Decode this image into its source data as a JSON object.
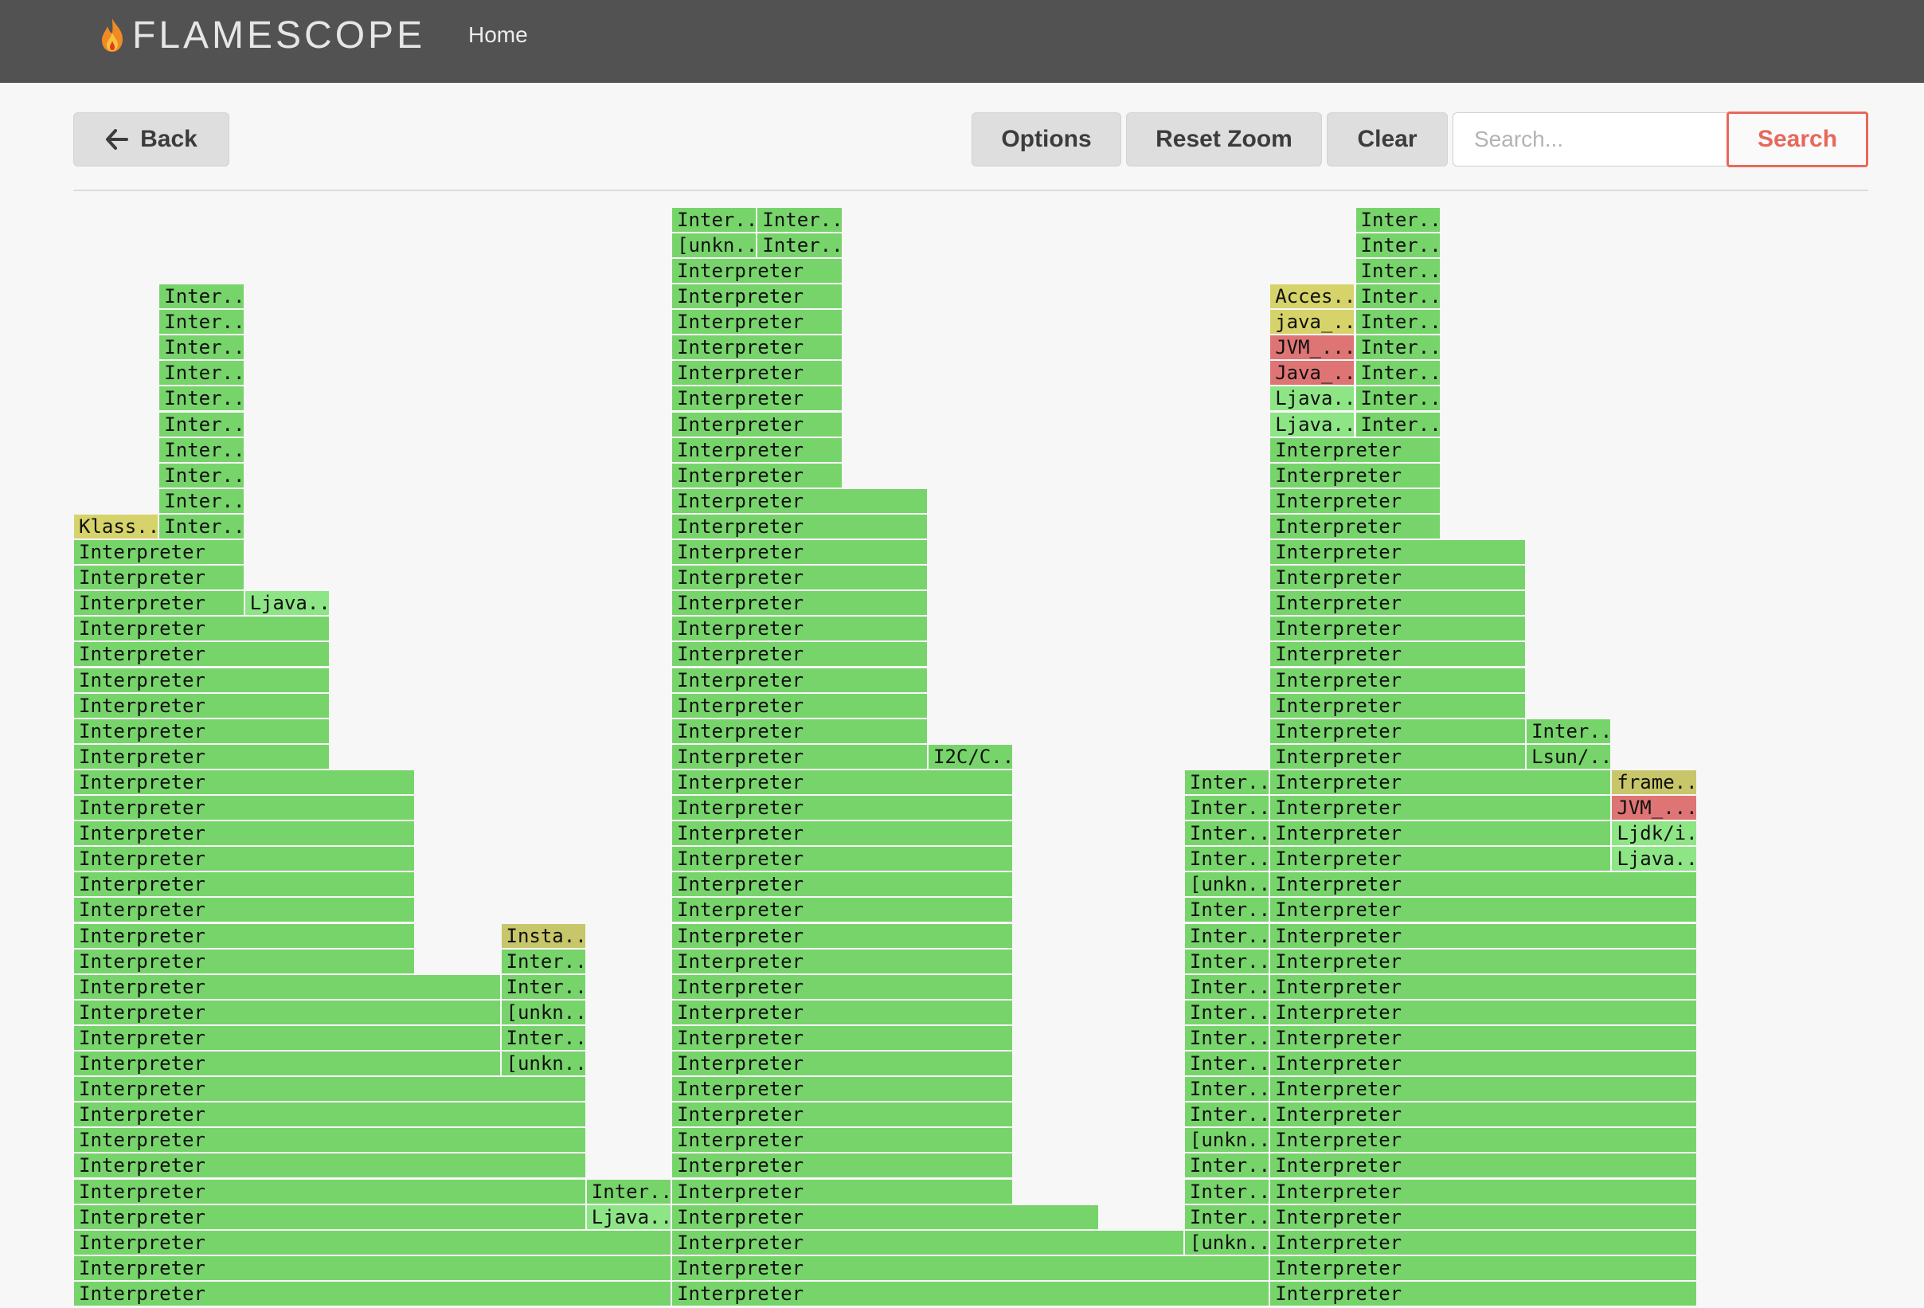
{
  "app": {
    "title": "FLAMESCOPE",
    "nav_home": "Home"
  },
  "toolbar": {
    "back_label": "Back",
    "options_label": "Options",
    "reset_zoom_label": "Reset Zoom",
    "clear_label": "Clear",
    "search_placeholder": "Search...",
    "search_label": "Search"
  },
  "colors": {
    "interpreter": "#77d46b",
    "light_green": "#8ee585",
    "yellow": "#d6d36a",
    "olive": "#c7c66a",
    "red": "#df7474",
    "accent": "#e8685a",
    "navbar": "#525252"
  },
  "flamegraph": {
    "frames": [
      {
        "c": 0,
        "r": 1,
        "w": 7,
        "t": "Interpreter",
        "k": "g"
      },
      {
        "c": 7,
        "r": 1,
        "w": 7,
        "t": "Interpreter",
        "k": "g"
      },
      {
        "c": 14,
        "r": 1,
        "w": 5,
        "t": "Interpreter",
        "k": "g"
      },
      {
        "c": 0,
        "r": 2,
        "w": 7,
        "t": "Interpreter",
        "k": "g"
      },
      {
        "c": 7,
        "r": 2,
        "w": 7,
        "t": "Interpreter",
        "k": "g"
      },
      {
        "c": 14,
        "r": 2,
        "w": 5,
        "t": "Interpreter",
        "k": "g"
      },
      {
        "c": 0,
        "r": 3,
        "w": 7,
        "t": "Interpreter",
        "k": "g"
      },
      {
        "c": 7,
        "r": 3,
        "w": 6,
        "t": "Interpreter",
        "k": "g"
      },
      {
        "c": 13,
        "r": 3,
        "w": 1,
        "t": "[unkn...",
        "k": "g"
      },
      {
        "c": 14,
        "r": 3,
        "w": 5,
        "t": "Interpreter",
        "k": "g"
      },
      {
        "c": 0,
        "r": 4,
        "w": 6,
        "t": "Interpreter",
        "k": "g"
      },
      {
        "c": 6,
        "r": 4,
        "w": 1,
        "t": "Ljava...",
        "k": "l"
      },
      {
        "c": 7,
        "r": 4,
        "w": 5,
        "t": "Interpreter",
        "k": "g"
      },
      {
        "c": 13,
        "r": 4,
        "w": 1,
        "t": "Inter...",
        "k": "g"
      },
      {
        "c": 14,
        "r": 4,
        "w": 5,
        "t": "Interpreter",
        "k": "g"
      },
      {
        "c": 0,
        "r": 5,
        "w": 6,
        "t": "Interpreter",
        "k": "g"
      },
      {
        "c": 6,
        "r": 5,
        "w": 1,
        "t": "Inter...",
        "k": "g"
      },
      {
        "c": 7,
        "r": 5,
        "w": 4,
        "t": "Interpreter",
        "k": "g"
      },
      {
        "c": 13,
        "r": 5,
        "w": 1,
        "t": "Inter...",
        "k": "g"
      },
      {
        "c": 14,
        "r": 5,
        "w": 5,
        "t": "Interpreter",
        "k": "g"
      },
      {
        "c": 0,
        "r": 6,
        "w": 6,
        "t": "Interpreter",
        "k": "g"
      },
      {
        "c": 7,
        "r": 6,
        "w": 4,
        "t": "Interpreter",
        "k": "g"
      },
      {
        "c": 13,
        "r": 6,
        "w": 1,
        "t": "Inter...",
        "k": "g"
      },
      {
        "c": 14,
        "r": 6,
        "w": 5,
        "t": "Interpreter",
        "k": "g"
      },
      {
        "c": 0,
        "r": 7,
        "w": 6,
        "t": "Interpreter",
        "k": "g"
      },
      {
        "c": 7,
        "r": 7,
        "w": 4,
        "t": "Interpreter",
        "k": "g"
      },
      {
        "c": 13,
        "r": 7,
        "w": 1,
        "t": "[unkn...",
        "k": "g"
      },
      {
        "c": 14,
        "r": 7,
        "w": 5,
        "t": "Interpreter",
        "k": "g"
      },
      {
        "c": 0,
        "r": 8,
        "w": 6,
        "t": "Interpreter",
        "k": "g"
      },
      {
        "c": 7,
        "r": 8,
        "w": 4,
        "t": "Interpreter",
        "k": "g"
      },
      {
        "c": 13,
        "r": 8,
        "w": 1,
        "t": "Inter...",
        "k": "g"
      },
      {
        "c": 14,
        "r": 8,
        "w": 5,
        "t": "Interpreter",
        "k": "g"
      },
      {
        "c": 0,
        "r": 9,
        "w": 6,
        "t": "Interpreter",
        "k": "g"
      },
      {
        "c": 7,
        "r": 9,
        "w": 4,
        "t": "Interpreter",
        "k": "g"
      },
      {
        "c": 13,
        "r": 9,
        "w": 1,
        "t": "Inter...",
        "k": "g"
      },
      {
        "c": 14,
        "r": 9,
        "w": 5,
        "t": "Interpreter",
        "k": "g"
      },
      {
        "c": 0,
        "r": 10,
        "w": 5,
        "t": "Interpreter",
        "k": "g"
      },
      {
        "c": 5,
        "r": 10,
        "w": 1,
        "t": "[unkn...",
        "k": "g"
      },
      {
        "c": 7,
        "r": 10,
        "w": 4,
        "t": "Interpreter",
        "k": "g"
      },
      {
        "c": 13,
        "r": 10,
        "w": 1,
        "t": "Inter...",
        "k": "g"
      },
      {
        "c": 14,
        "r": 10,
        "w": 5,
        "t": "Interpreter",
        "k": "g"
      },
      {
        "c": 0,
        "r": 11,
        "w": 5,
        "t": "Interpreter",
        "k": "g"
      },
      {
        "c": 5,
        "r": 11,
        "w": 1,
        "t": "Inter...",
        "k": "g"
      },
      {
        "c": 7,
        "r": 11,
        "w": 4,
        "t": "Interpreter",
        "k": "g"
      },
      {
        "c": 13,
        "r": 11,
        "w": 1,
        "t": "Inter...",
        "k": "g"
      },
      {
        "c": 14,
        "r": 11,
        "w": 5,
        "t": "Interpreter",
        "k": "g"
      },
      {
        "c": 0,
        "r": 12,
        "w": 5,
        "t": "Interpreter",
        "k": "g"
      },
      {
        "c": 5,
        "r": 12,
        "w": 1,
        "t": "[unkn...",
        "k": "g"
      },
      {
        "c": 7,
        "r": 12,
        "w": 4,
        "t": "Interpreter",
        "k": "g"
      },
      {
        "c": 13,
        "r": 12,
        "w": 1,
        "t": "Inter...",
        "k": "g"
      },
      {
        "c": 14,
        "r": 12,
        "w": 5,
        "t": "Interpreter",
        "k": "g"
      },
      {
        "c": 0,
        "r": 13,
        "w": 5,
        "t": "Interpreter",
        "k": "g"
      },
      {
        "c": 5,
        "r": 13,
        "w": 1,
        "t": "Inter...",
        "k": "g"
      },
      {
        "c": 7,
        "r": 13,
        "w": 4,
        "t": "Interpreter",
        "k": "g"
      },
      {
        "c": 13,
        "r": 13,
        "w": 1,
        "t": "Inter...",
        "k": "g"
      },
      {
        "c": 14,
        "r": 13,
        "w": 5,
        "t": "Interpreter",
        "k": "g"
      },
      {
        "c": 0,
        "r": 14,
        "w": 4,
        "t": "Interpreter",
        "k": "g"
      },
      {
        "c": 5,
        "r": 14,
        "w": 1,
        "t": "Inter...",
        "k": "g"
      },
      {
        "c": 7,
        "r": 14,
        "w": 4,
        "t": "Interpreter",
        "k": "g"
      },
      {
        "c": 13,
        "r": 14,
        "w": 1,
        "t": "Inter...",
        "k": "g"
      },
      {
        "c": 14,
        "r": 14,
        "w": 5,
        "t": "Interpreter",
        "k": "g"
      },
      {
        "c": 0,
        "r": 15,
        "w": 4,
        "t": "Interpreter",
        "k": "g"
      },
      {
        "c": 5,
        "r": 15,
        "w": 1,
        "t": "Insta...",
        "k": "o"
      },
      {
        "c": 7,
        "r": 15,
        "w": 4,
        "t": "Interpreter",
        "k": "g"
      },
      {
        "c": 13,
        "r": 15,
        "w": 1,
        "t": "Inter...",
        "k": "g"
      },
      {
        "c": 14,
        "r": 15,
        "w": 5,
        "t": "Interpreter",
        "k": "g"
      },
      {
        "c": 0,
        "r": 16,
        "w": 4,
        "t": "Interpreter",
        "k": "g"
      },
      {
        "c": 7,
        "r": 16,
        "w": 4,
        "t": "Interpreter",
        "k": "g"
      },
      {
        "c": 13,
        "r": 16,
        "w": 1,
        "t": "Inter...",
        "k": "g"
      },
      {
        "c": 14,
        "r": 16,
        "w": 5,
        "t": "Interpreter",
        "k": "g"
      },
      {
        "c": 0,
        "r": 17,
        "w": 4,
        "t": "Interpreter",
        "k": "g"
      },
      {
        "c": 7,
        "r": 17,
        "w": 4,
        "t": "Interpreter",
        "k": "g"
      },
      {
        "c": 13,
        "r": 17,
        "w": 1,
        "t": "[unkn...",
        "k": "g"
      },
      {
        "c": 14,
        "r": 17,
        "w": 5,
        "t": "Interpreter",
        "k": "g"
      },
      {
        "c": 0,
        "r": 18,
        "w": 4,
        "t": "Interpreter",
        "k": "g"
      },
      {
        "c": 7,
        "r": 18,
        "w": 4,
        "t": "Interpreter",
        "k": "g"
      },
      {
        "c": 13,
        "r": 18,
        "w": 1,
        "t": "Inter...",
        "k": "g"
      },
      {
        "c": 14,
        "r": 18,
        "w": 4,
        "t": "Interpreter",
        "k": "g"
      },
      {
        "c": 18,
        "r": 18,
        "w": 1,
        "t": "Ljava...",
        "k": "l"
      },
      {
        "c": 0,
        "r": 19,
        "w": 4,
        "t": "Interpreter",
        "k": "g"
      },
      {
        "c": 7,
        "r": 19,
        "w": 4,
        "t": "Interpreter",
        "k": "g"
      },
      {
        "c": 13,
        "r": 19,
        "w": 1,
        "t": "Inter...",
        "k": "g"
      },
      {
        "c": 14,
        "r": 19,
        "w": 4,
        "t": "Interpreter",
        "k": "g"
      },
      {
        "c": 18,
        "r": 19,
        "w": 1,
        "t": "Ljdk/i...",
        "k": "l"
      },
      {
        "c": 0,
        "r": 20,
        "w": 4,
        "t": "Interpreter",
        "k": "g"
      },
      {
        "c": 7,
        "r": 20,
        "w": 4,
        "t": "Interpreter",
        "k": "g"
      },
      {
        "c": 13,
        "r": 20,
        "w": 1,
        "t": "Inter...",
        "k": "g"
      },
      {
        "c": 14,
        "r": 20,
        "w": 4,
        "t": "Interpreter",
        "k": "g"
      },
      {
        "c": 18,
        "r": 20,
        "w": 1,
        "t": "JVM_...",
        "k": "r"
      },
      {
        "c": 0,
        "r": 21,
        "w": 4,
        "t": "Interpreter",
        "k": "g"
      },
      {
        "c": 7,
        "r": 21,
        "w": 4,
        "t": "Interpreter",
        "k": "g"
      },
      {
        "c": 13,
        "r": 21,
        "w": 1,
        "t": "Inter...",
        "k": "g"
      },
      {
        "c": 14,
        "r": 21,
        "w": 4,
        "t": "Interpreter",
        "k": "g"
      },
      {
        "c": 18,
        "r": 21,
        "w": 1,
        "t": "frame...",
        "k": "o"
      },
      {
        "c": 0,
        "r": 22,
        "w": 3,
        "t": "Interpreter",
        "k": "g"
      },
      {
        "c": 7,
        "r": 22,
        "w": 3,
        "t": "Interpreter",
        "k": "g"
      },
      {
        "c": 10,
        "r": 22,
        "w": 1,
        "t": "I2C/C...",
        "k": "g"
      },
      {
        "c": 14,
        "r": 22,
        "w": 3,
        "t": "Interpreter",
        "k": "g"
      },
      {
        "c": 17,
        "r": 22,
        "w": 1,
        "t": "Lsun/...",
        "k": "g"
      },
      {
        "c": 0,
        "r": 23,
        "w": 3,
        "t": "Interpreter",
        "k": "g"
      },
      {
        "c": 7,
        "r": 23,
        "w": 3,
        "t": "Interpreter",
        "k": "g"
      },
      {
        "c": 14,
        "r": 23,
        "w": 3,
        "t": "Interpreter",
        "k": "g"
      },
      {
        "c": 17,
        "r": 23,
        "w": 1,
        "t": "Inter...",
        "k": "g"
      },
      {
        "c": 0,
        "r": 24,
        "w": 3,
        "t": "Interpreter",
        "k": "g"
      },
      {
        "c": 7,
        "r": 24,
        "w": 3,
        "t": "Interpreter",
        "k": "g"
      },
      {
        "c": 14,
        "r": 24,
        "w": 3,
        "t": "Interpreter",
        "k": "g"
      },
      {
        "c": 0,
        "r": 25,
        "w": 3,
        "t": "Interpreter",
        "k": "g"
      },
      {
        "c": 7,
        "r": 25,
        "w": 3,
        "t": "Interpreter",
        "k": "g"
      },
      {
        "c": 14,
        "r": 25,
        "w": 3,
        "t": "Interpreter",
        "k": "g"
      },
      {
        "c": 0,
        "r": 26,
        "w": 3,
        "t": "Interpreter",
        "k": "g"
      },
      {
        "c": 7,
        "r": 26,
        "w": 3,
        "t": "Interpreter",
        "k": "g"
      },
      {
        "c": 14,
        "r": 26,
        "w": 3,
        "t": "Interpreter",
        "k": "g"
      },
      {
        "c": 0,
        "r": 27,
        "w": 3,
        "t": "Interpreter",
        "k": "g"
      },
      {
        "c": 7,
        "r": 27,
        "w": 3,
        "t": "Interpreter",
        "k": "g"
      },
      {
        "c": 14,
        "r": 27,
        "w": 3,
        "t": "Interpreter",
        "k": "g"
      },
      {
        "c": 0,
        "r": 28,
        "w": 2,
        "t": "Interpreter",
        "k": "g"
      },
      {
        "c": 2,
        "r": 28,
        "w": 1,
        "t": "Ljava...",
        "k": "l"
      },
      {
        "c": 7,
        "r": 28,
        "w": 3,
        "t": "Interpreter",
        "k": "g"
      },
      {
        "c": 14,
        "r": 28,
        "w": 3,
        "t": "Interpreter",
        "k": "g"
      },
      {
        "c": 0,
        "r": 29,
        "w": 2,
        "t": "Interpreter",
        "k": "g"
      },
      {
        "c": 7,
        "r": 29,
        "w": 3,
        "t": "Interpreter",
        "k": "g"
      },
      {
        "c": 14,
        "r": 29,
        "w": 3,
        "t": "Interpreter",
        "k": "g"
      },
      {
        "c": 0,
        "r": 30,
        "w": 2,
        "t": "Interpreter",
        "k": "g"
      },
      {
        "c": 7,
        "r": 30,
        "w": 3,
        "t": "Interpreter",
        "k": "g"
      },
      {
        "c": 14,
        "r": 30,
        "w": 3,
        "t": "Interpreter",
        "k": "g"
      },
      {
        "c": 0,
        "r": 31,
        "w": 1,
        "t": "Klass...",
        "k": "y"
      },
      {
        "c": 1,
        "r": 31,
        "w": 1,
        "t": "Inter...",
        "k": "g"
      },
      {
        "c": 7,
        "r": 31,
        "w": 3,
        "t": "Interpreter",
        "k": "g"
      },
      {
        "c": 14,
        "r": 31,
        "w": 2,
        "t": "Interpreter",
        "k": "g"
      },
      {
        "c": 1,
        "r": 32,
        "w": 1,
        "t": "Inter...",
        "k": "g"
      },
      {
        "c": 7,
        "r": 32,
        "w": 3,
        "t": "Interpreter",
        "k": "g"
      },
      {
        "c": 14,
        "r": 32,
        "w": 2,
        "t": "Interpreter",
        "k": "g"
      },
      {
        "c": 1,
        "r": 33,
        "w": 1,
        "t": "Inter...",
        "k": "g"
      },
      {
        "c": 7,
        "r": 33,
        "w": 2,
        "t": "Interpreter",
        "k": "g"
      },
      {
        "c": 14,
        "r": 33,
        "w": 2,
        "t": "Interpreter",
        "k": "g"
      },
      {
        "c": 1,
        "r": 34,
        "w": 1,
        "t": "Inter...",
        "k": "g"
      },
      {
        "c": 7,
        "r": 34,
        "w": 2,
        "t": "Interpreter",
        "k": "g"
      },
      {
        "c": 14,
        "r": 34,
        "w": 2,
        "t": "Interpreter",
        "k": "g"
      },
      {
        "c": 1,
        "r": 35,
        "w": 1,
        "t": "Inter...",
        "k": "g"
      },
      {
        "c": 7,
        "r": 35,
        "w": 2,
        "t": "Interpreter",
        "k": "g"
      },
      {
        "c": 14,
        "r": 35,
        "w": 1,
        "t": "Ljava...",
        "k": "l"
      },
      {
        "c": 15,
        "r": 35,
        "w": 1,
        "t": "Inter...",
        "k": "g"
      },
      {
        "c": 1,
        "r": 36,
        "w": 1,
        "t": "Inter...",
        "k": "g"
      },
      {
        "c": 7,
        "r": 36,
        "w": 2,
        "t": "Interpreter",
        "k": "g"
      },
      {
        "c": 14,
        "r": 36,
        "w": 1,
        "t": "Ljava...",
        "k": "l"
      },
      {
        "c": 15,
        "r": 36,
        "w": 1,
        "t": "Inter...",
        "k": "g"
      },
      {
        "c": 1,
        "r": 37,
        "w": 1,
        "t": "Inter...",
        "k": "g"
      },
      {
        "c": 7,
        "r": 37,
        "w": 2,
        "t": "Interpreter",
        "k": "g"
      },
      {
        "c": 14,
        "r": 37,
        "w": 1,
        "t": "Java_...",
        "k": "r"
      },
      {
        "c": 15,
        "r": 37,
        "w": 1,
        "t": "Inter...",
        "k": "g"
      },
      {
        "c": 1,
        "r": 38,
        "w": 1,
        "t": "Inter...",
        "k": "g"
      },
      {
        "c": 7,
        "r": 38,
        "w": 2,
        "t": "Interpreter",
        "k": "g"
      },
      {
        "c": 14,
        "r": 38,
        "w": 1,
        "t": "JVM_...",
        "k": "r"
      },
      {
        "c": 15,
        "r": 38,
        "w": 1,
        "t": "Inter...",
        "k": "g"
      },
      {
        "c": 1,
        "r": 39,
        "w": 1,
        "t": "Inter...",
        "k": "g"
      },
      {
        "c": 7,
        "r": 39,
        "w": 2,
        "t": "Interpreter",
        "k": "g"
      },
      {
        "c": 14,
        "r": 39,
        "w": 1,
        "t": "java_...",
        "k": "y"
      },
      {
        "c": 15,
        "r": 39,
        "w": 1,
        "t": "Inter...",
        "k": "g"
      },
      {
        "c": 1,
        "r": 40,
        "w": 1,
        "t": "Inter...",
        "k": "g"
      },
      {
        "c": 7,
        "r": 40,
        "w": 2,
        "t": "Interpreter",
        "k": "g"
      },
      {
        "c": 14,
        "r": 40,
        "w": 1,
        "t": "Acces...",
        "k": "y"
      },
      {
        "c": 15,
        "r": 40,
        "w": 1,
        "t": "Inter...",
        "k": "g"
      },
      {
        "c": 7,
        "r": 41,
        "w": 2,
        "t": "Interpreter",
        "k": "g"
      },
      {
        "c": 15,
        "r": 41,
        "w": 1,
        "t": "Inter...",
        "k": "g"
      },
      {
        "c": 7,
        "r": 42,
        "w": 1,
        "t": "[unkn...",
        "k": "g"
      },
      {
        "c": 8,
        "r": 42,
        "w": 1,
        "t": "Inter...",
        "k": "g"
      },
      {
        "c": 15,
        "r": 42,
        "w": 1,
        "t": "Inter...",
        "k": "g"
      },
      {
        "c": 7,
        "r": 43,
        "w": 1,
        "t": "Inter...",
        "k": "g"
      },
      {
        "c": 8,
        "r": 43,
        "w": 1,
        "t": "Inter...",
        "k": "g"
      },
      {
        "c": 15,
        "r": 43,
        "w": 1,
        "t": "Inter...",
        "k": "g"
      }
    ]
  }
}
